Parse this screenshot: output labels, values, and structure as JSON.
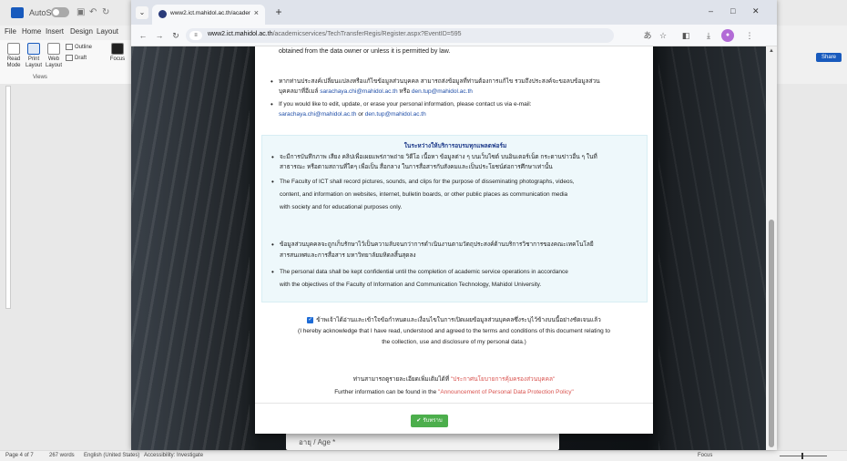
{
  "word": {
    "autosave_label": "AutoSave",
    "autosave_state": "Off",
    "tabs": [
      "File",
      "Home",
      "Insert",
      "Design",
      "Layout"
    ],
    "ribbon": {
      "read_mode": "Read Mode",
      "print_layout": "Print Layout",
      "web_layout": "Web Layout",
      "outline": "Outline",
      "draft": "Draft",
      "focus": "Focus",
      "group_views": "Views",
      "share": "Share"
    },
    "status": {
      "page": "Page 4 of 7",
      "words": "267 words",
      "language": "English (United States)",
      "accessibility": "Accessibility: Investigate",
      "focus": "Focus"
    }
  },
  "browser": {
    "tab_title": "www2.ict.mahidol.ac.th/academ",
    "url_host": "www2.ict.mahidol.ac.th",
    "url_path": "/academicservices/TechTransferRegis/Register.aspx?EventID=595",
    "window_controls": {
      "minimize": "–",
      "maximize": "□",
      "close": "✕"
    }
  },
  "modal": {
    "top_text": "obtained from the data owner or unless it is permitted by law.",
    "thai_contact_1": "หากท่านประสงค์เปลี่ยนแปลงหรือแก้ไขข้อมูลส่วนบุคคล สามารถส่งข้อมูลที่ท่านต้องการแก้ไข รวมถึงประสงค์จะขอลบข้อมูลส่วน",
    "thai_contact_2_prefix": "บุคคลมาที่อีเมล์",
    "email_1": "sarachaya.chi@mahidol.ac.th",
    "thai_or": "หรือ",
    "email_2": "den.tup@mahidol.ac.th",
    "en_contact_1": "If you would like to edit, update, or erase your personal information, please contact us via e-mail:",
    "en_or": "or",
    "notice_title": "ในระหว่างให้บริการอบรมทุกแพลตฟอร์ม",
    "notice_th_1a": "จะมีการบันทึกภาพ เสียง คลิปเพื่อเผยแพร่ภาพถ่าย วิดีโอ เนื้อหา ข้อมูลต่าง ๆ บนเว็บไซต์ บนอินเตอร์เน็ต กระดานข่าวอื่น ๆ ในที่",
    "notice_th_1b": "สาธารณะ หรือตามสถานที่ใดๆ เพื่อเป็น สื่อกลาง ในการสื่อสารกับสังคมและเป็นประโยชน์ต่อการศึกษาเท่านั้น",
    "notice_en_1a": "The Faculty of ICT shall record pictures, sounds, and clips for the purpose of disseminating photographs, videos,",
    "notice_en_1b": "content, and information on websites, internet, bulletin boards, or other public places as communication media",
    "notice_en_1c": "with society and for educational purposes only.",
    "notice_th_2a": "ข้อมูลส่วนบุคคลจะถูกเก็บรักษาไว้เป็นความลับจนกว่าการดำเนินงานตามวัตถุประสงค์ด้านบริการวิชาการของคณะเทคโนโลยี",
    "notice_th_2b": "สารสนเทศและการสื่อสาร มหาวิทยาลัยมหิดลสิ้นสุดลง",
    "notice_en_2a": "The personal data shall be kept confidential until the completion of academic service operations in accordance",
    "notice_en_2b": "with the objectives of the Faculty of Information and Communication Technology, Mahidol University.",
    "ack_th": "ข้าพเจ้าได้อ่านและเข้าใจข้อกำหนดและเงื่อนไขในการเปิดเผยข้อมูลส่วนบุคคลซึ่งระบุไว้ข้างบนนี้อย่างชัดเจนแล้ว",
    "ack_en_1": "(I hereby acknowledge that I have read, understood and agreed to the terms and conditions of this document relating to",
    "ack_en_2": "the collection, use and disclosure of my personal data.)",
    "more_th": "ท่านสามารถดูรายละเอียดเพิ่มเติมได้ที่",
    "more_th_link": "\"ประกาศนโยบายการคุ้มครองส่วนบุคคล\"",
    "more_en": "Further information can be found in the",
    "more_en_link": "\"Announcement of Personal Data Protection Policy\"",
    "ok_label": "รับทราบ"
  },
  "page_behind": {
    "age_label": "อายุ / Age *"
  },
  "colors": {
    "accent": "#1d3a8a",
    "link": "#1f4ea8",
    "policy_link": "#d9534f",
    "ok_button": "#4cae4c",
    "notice_bg": "#eef8fb"
  }
}
